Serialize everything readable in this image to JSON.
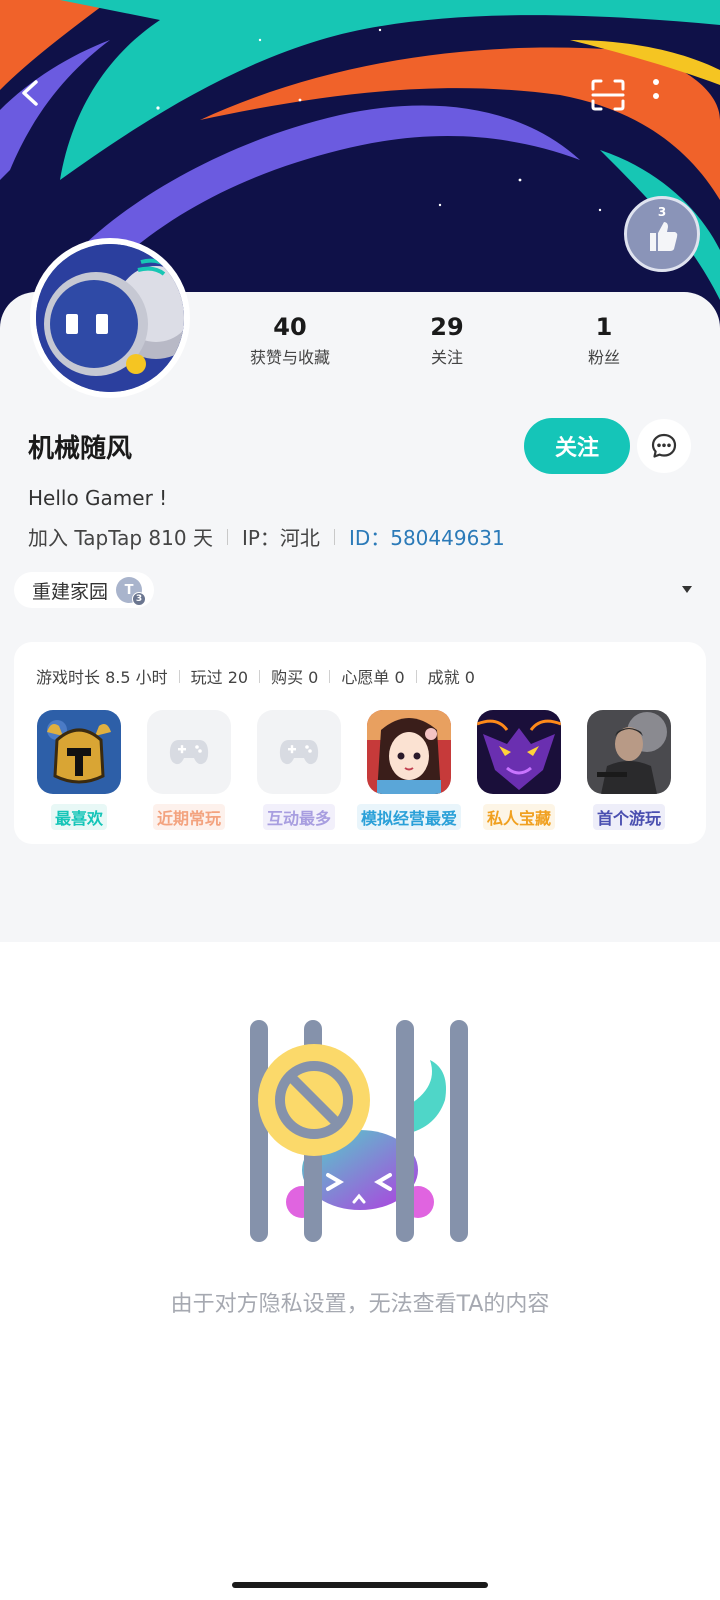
{
  "header": {
    "back_icon": "chevron-left-icon",
    "scan_icon": "scan-icon",
    "more_icon": "more-vertical-icon",
    "badge": {
      "level": "3"
    }
  },
  "profile": {
    "stats": [
      {
        "value": "40",
        "label": "获赞与收藏"
      },
      {
        "value": "29",
        "label": "关注"
      },
      {
        "value": "1",
        "label": "粉丝"
      }
    ],
    "username": "机械随风",
    "follow_label": "关注",
    "bio": "Hello Gamer !",
    "joined": "加入 TapTap 810 天",
    "ip": "IP：河北",
    "id": "ID：580449631",
    "guild": {
      "name": "重建家园",
      "badge": "T",
      "badge_level": "3"
    }
  },
  "games": {
    "stats": [
      "游戏时长 8.5 小时",
      "玩过 20",
      "购买 0",
      "心愿单 0",
      "成就 0"
    ],
    "items": [
      {
        "tag": "最喜欢",
        "color": "#15c5b8",
        "bg": "#e8f8f6",
        "has_icon": true
      },
      {
        "tag": "近期常玩",
        "color": "#f3a37f",
        "bg": "#fdf1ec",
        "has_icon": false
      },
      {
        "tag": "互动最多",
        "color": "#a89ee0",
        "bg": "#f2f0fb",
        "has_icon": false
      },
      {
        "tag": "模拟经营最爱",
        "color": "#2aa0d8",
        "bg": "#e9f5fb",
        "has_icon": true
      },
      {
        "tag": "私人宝藏",
        "color": "#f0a020",
        "bg": "#fdf5e6",
        "has_icon": true
      },
      {
        "tag": "首个游玩",
        "color": "#4a4fb0",
        "bg": "#eeeef9",
        "has_icon": true
      }
    ]
  },
  "privacy": {
    "message": "由于对方隐私设置，无法查看TA的内容"
  },
  "colors": {
    "accent": "#15c5b8",
    "id_link": "#2b7ab8",
    "banner_bg": "#0f1148"
  }
}
